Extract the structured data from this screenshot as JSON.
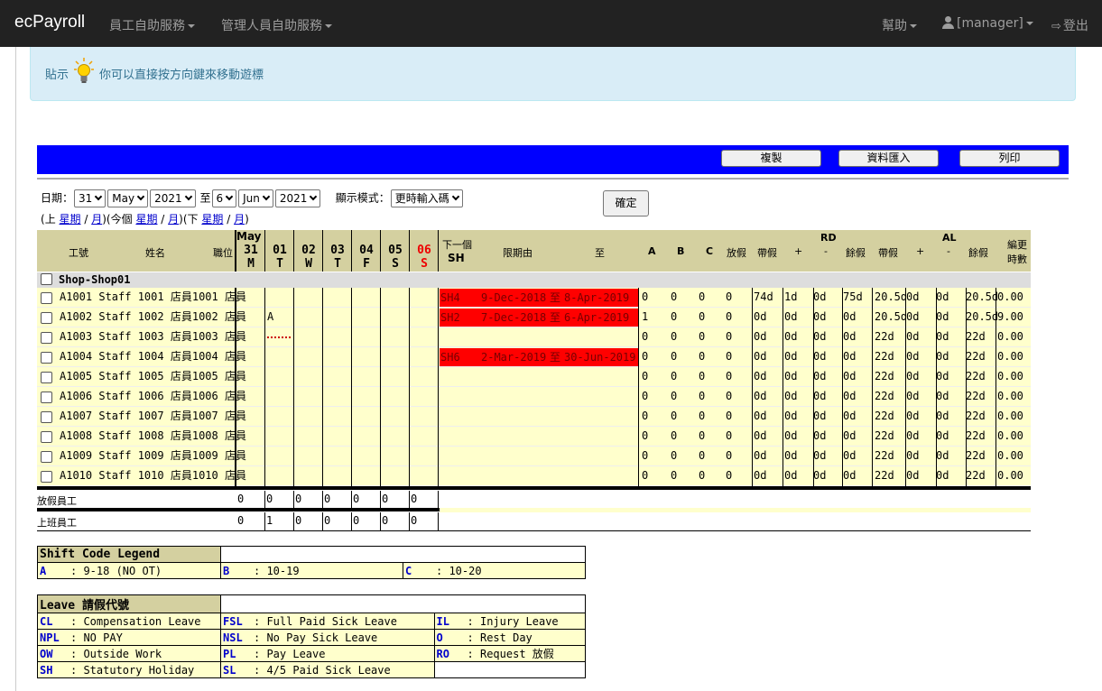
{
  "navbar": {
    "brand": "ecPayroll",
    "menu_employee": "員工自助服務",
    "menu_manager": "管理人員自助服務",
    "help": "幫助",
    "user": "[manager]",
    "logout": "登出"
  },
  "tip": {
    "label": "貼示",
    "text": "你可以直接按方向鍵來移動遊標"
  },
  "toolbar": {
    "copy": "複製",
    "import": "資料匯入",
    "print": "列印"
  },
  "filter": {
    "date_label": "日期：",
    "from_day": "31",
    "from_month": "May",
    "from_year": "2021",
    "to_label": "至",
    "to_day": "6",
    "to_month": "Jun",
    "to_year": "2021",
    "mode_label": "顯示模式：",
    "mode_value": "更時輸入碼",
    "confirm": "確定",
    "nav": {
      "prev_label": "上",
      "week": "星期",
      "month": "月",
      "this_label": "今個",
      "next_label": "下"
    }
  },
  "grid": {
    "headers": {
      "emp_id": "工號",
      "name": "姓名",
      "position": "職位",
      "month": "May",
      "next_sh_line1": "下一個",
      "next_sh_line2": "SH",
      "period_from": "限期由",
      "period_to": "至",
      "a": "A",
      "b": "B",
      "c": "C",
      "leave": "放假",
      "rd": "RD",
      "al": "AL",
      "carry": "帶假",
      "plus": "+",
      "minus": "-",
      "remain": "餘假",
      "shift_hours_1": "編更",
      "shift_hours_2": "時數"
    },
    "days": [
      {
        "d": "31",
        "w": "M",
        "red": false
      },
      {
        "d": "01",
        "w": "T",
        "red": false
      },
      {
        "d": "02",
        "w": "W",
        "red": false
      },
      {
        "d": "03",
        "w": "T",
        "red": false
      },
      {
        "d": "04",
        "w": "F",
        "red": false
      },
      {
        "d": "05",
        "w": "S",
        "red": false
      },
      {
        "d": "06",
        "w": "S",
        "red": true
      }
    ],
    "shop": "Shop-Shop01",
    "rows": [
      {
        "id": "A1001",
        "name": "Staff 1001",
        "pos": "店員1001 店員",
        "d01": "",
        "sh": "SH4",
        "from": "9-Dec-2018",
        "to_sep": "至",
        "to": "8-Apr-2019",
        "a": "0",
        "b": "0",
        "c": "0",
        "leave": "0",
        "rd": [
          "74d",
          "1d",
          "0d",
          "75d"
        ],
        "al": [
          "20.5d",
          "0d",
          "0d",
          "20.5d"
        ],
        "hours": "0.00"
      },
      {
        "id": "A1002",
        "name": "Staff 1002",
        "pos": "店員1002 店員",
        "d01": "A",
        "sh": "SH2",
        "from": "7-Dec-2018",
        "to_sep": "至",
        "to": "6-Apr-2019",
        "a": "1",
        "b": "0",
        "c": "0",
        "leave": "0",
        "rd": [
          "0d",
          "0d",
          "0d",
          "0d"
        ],
        "al": [
          "20.5d",
          "0d",
          "0d",
          "20.5d"
        ],
        "hours": "9.00"
      },
      {
        "id": "A1003",
        "name": "Staff 1003",
        "pos": "店員1003 店員",
        "d01": "",
        "sh": "",
        "from": "",
        "to_sep": "",
        "to": "",
        "a": "0",
        "b": "0",
        "c": "0",
        "leave": "0",
        "rd": [
          "0d",
          "0d",
          "0d",
          "0d"
        ],
        "al": [
          "22d",
          "0d",
          "0d",
          "22d"
        ],
        "hours": "0.00"
      },
      {
        "id": "A1004",
        "name": "Staff 1004",
        "pos": "店員1004 店員",
        "d01": "",
        "sh": "SH6",
        "from": "2-Mar-2019",
        "to_sep": "至",
        "to": "30-Jun-2019",
        "a": "0",
        "b": "0",
        "c": "0",
        "leave": "0",
        "rd": [
          "0d",
          "0d",
          "0d",
          "0d"
        ],
        "al": [
          "22d",
          "0d",
          "0d",
          "22d"
        ],
        "hours": "0.00"
      },
      {
        "id": "A1005",
        "name": "Staff 1005",
        "pos": "店員1005 店員",
        "d01": "",
        "sh": "",
        "from": "",
        "to_sep": "",
        "to": "",
        "a": "0",
        "b": "0",
        "c": "0",
        "leave": "0",
        "rd": [
          "0d",
          "0d",
          "0d",
          "0d"
        ],
        "al": [
          "22d",
          "0d",
          "0d",
          "22d"
        ],
        "hours": "0.00"
      },
      {
        "id": "A1006",
        "name": "Staff 1006",
        "pos": "店員1006 店員",
        "d01": "",
        "sh": "",
        "from": "",
        "to_sep": "",
        "to": "",
        "a": "0",
        "b": "0",
        "c": "0",
        "leave": "0",
        "rd": [
          "0d",
          "0d",
          "0d",
          "0d"
        ],
        "al": [
          "22d",
          "0d",
          "0d",
          "22d"
        ],
        "hours": "0.00"
      },
      {
        "id": "A1007",
        "name": "Staff 1007",
        "pos": "店員1007 店員",
        "d01": "",
        "sh": "",
        "from": "",
        "to_sep": "",
        "to": "",
        "a": "0",
        "b": "0",
        "c": "0",
        "leave": "0",
        "rd": [
          "0d",
          "0d",
          "0d",
          "0d"
        ],
        "al": [
          "22d",
          "0d",
          "0d",
          "22d"
        ],
        "hours": "0.00"
      },
      {
        "id": "A1008",
        "name": "Staff 1008",
        "pos": "店員1008 店員",
        "d01": "",
        "sh": "",
        "from": "",
        "to_sep": "",
        "to": "",
        "a": "0",
        "b": "0",
        "c": "0",
        "leave": "0",
        "rd": [
          "0d",
          "0d",
          "0d",
          "0d"
        ],
        "al": [
          "22d",
          "0d",
          "0d",
          "22d"
        ],
        "hours": "0.00"
      },
      {
        "id": "A1009",
        "name": "Staff 1009",
        "pos": "店員1009 店員",
        "d01": "",
        "sh": "",
        "from": "",
        "to_sep": "",
        "to": "",
        "a": "0",
        "b": "0",
        "c": "0",
        "leave": "0",
        "rd": [
          "0d",
          "0d",
          "0d",
          "0d"
        ],
        "al": [
          "22d",
          "0d",
          "0d",
          "22d"
        ],
        "hours": "0.00"
      },
      {
        "id": "A1010",
        "name": "Staff 1010",
        "pos": "店員1010 店員",
        "d01": "",
        "sh": "",
        "from": "",
        "to_sep": "",
        "to": "",
        "a": "0",
        "b": "0",
        "c": "0",
        "leave": "0",
        "rd": [
          "0d",
          "0d",
          "0d",
          "0d"
        ],
        "al": [
          "22d",
          "0d",
          "0d",
          "22d"
        ],
        "hours": "0.00"
      }
    ],
    "summary": {
      "off_label": "放假員工",
      "off_values": [
        "0",
        "0",
        "0",
        "0",
        "0",
        "0",
        "0"
      ],
      "on_label": "上班員工",
      "on_values": [
        "0",
        "1",
        "0",
        "0",
        "0",
        "0",
        "0"
      ]
    }
  },
  "shift_legend": {
    "title": "Shift Code Legend",
    "items": [
      {
        "code": "A",
        "desc": ": 9-18 (NO OT)"
      },
      {
        "code": "B",
        "desc": ": 10-19"
      },
      {
        "code": "C",
        "desc": ": 10-20"
      }
    ]
  },
  "leave_legend": {
    "title": "Leave 請假代號",
    "items": [
      {
        "code": "CL",
        "desc": ": Compensation Leave"
      },
      {
        "code": "FSL",
        "desc": ": Full Paid Sick Leave"
      },
      {
        "code": "IL",
        "desc": ": Injury Leave"
      },
      {
        "code": "NPL",
        "desc": ": NO PAY"
      },
      {
        "code": "NSL",
        "desc": ": No Pay Sick Leave"
      },
      {
        "code": "O",
        "desc": ": Rest Day"
      },
      {
        "code": "OW",
        "desc": ": Outside Work"
      },
      {
        "code": "PL",
        "desc": ": Pay Leave"
      },
      {
        "code": "RO",
        "desc": ": Request 放假"
      },
      {
        "code": "SH",
        "desc": ": Statutory Holiday"
      },
      {
        "code": "SL",
        "desc": ": 4/5 Paid Sick Leave"
      }
    ]
  }
}
